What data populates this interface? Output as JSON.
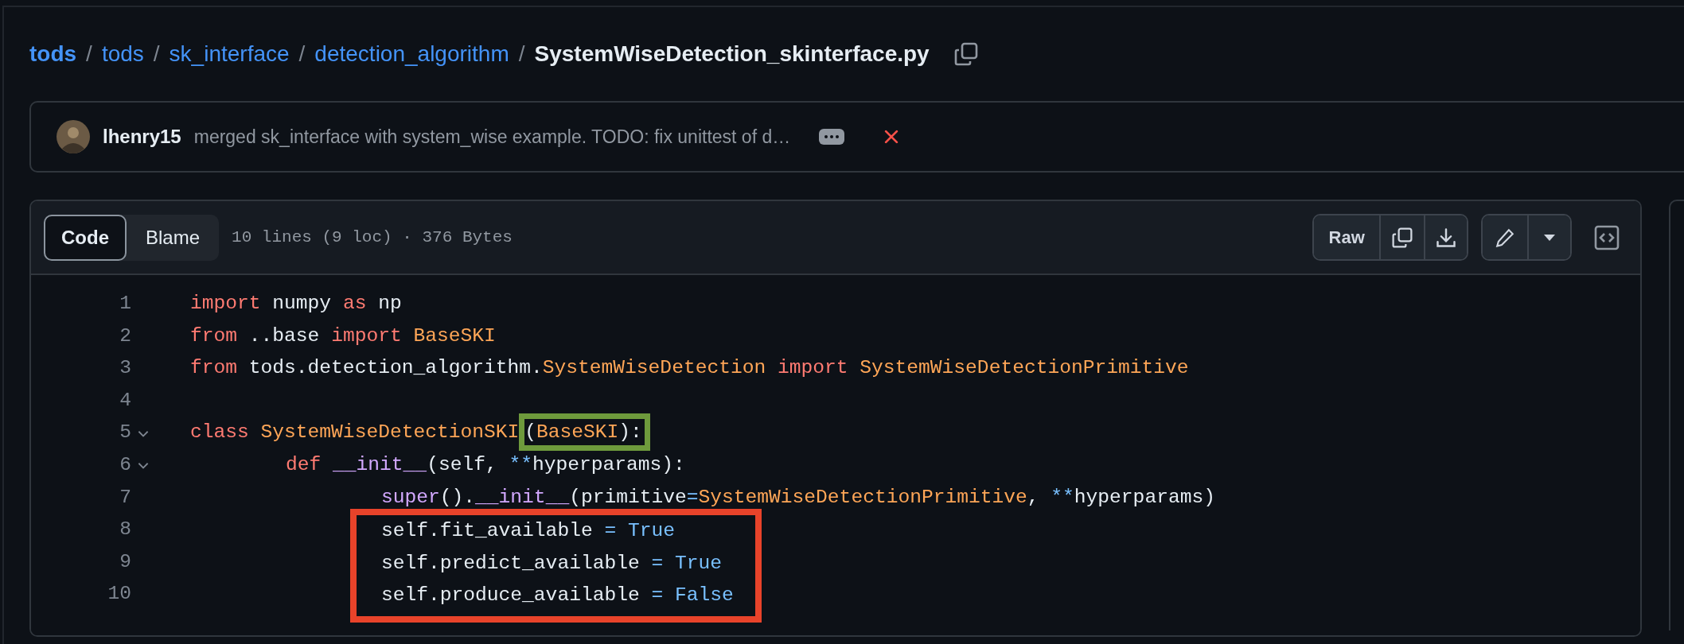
{
  "breadcrumb": [
    {
      "kind": "repo",
      "label": "tods"
    },
    {
      "kind": "separator",
      "label": "/"
    },
    {
      "kind": "link",
      "label": "tods"
    },
    {
      "kind": "separator",
      "label": "/"
    },
    {
      "kind": "link",
      "label": "sk_interface"
    },
    {
      "kind": "separator",
      "label": "/"
    },
    {
      "kind": "link",
      "label": "detection_algorithm"
    },
    {
      "kind": "separator",
      "label": "/"
    },
    {
      "kind": "current",
      "label": "SystemWiseDetection_skinterface.py"
    }
  ],
  "commit": {
    "author": "lhenry15",
    "message": "merged sk_interface with system_wise example. TODO: fix unittest of d…"
  },
  "file_view": {
    "tabs": [
      {
        "label": "Code",
        "selected": true
      },
      {
        "label": "Blame",
        "selected": false
      }
    ],
    "info": "10 lines (9 loc) · 376 Bytes",
    "raw_button": "Raw",
    "lines": [
      {
        "kind": "line",
        "number": "1",
        "tokens": [
          {
            "kind": "keyword",
            "text": "import"
          },
          {
            "kind": "plain",
            "text": " numpy "
          },
          {
            "kind": "keyword",
            "text": "as"
          },
          {
            "kind": "plain",
            "text": " np"
          }
        ]
      },
      {
        "kind": "line",
        "number": "2",
        "tokens": [
          {
            "kind": "keyword",
            "text": "from"
          },
          {
            "kind": "plain",
            "text": " ..base "
          },
          {
            "kind": "keyword",
            "text": "import "
          },
          {
            "kind": "name",
            "text": "BaseSKI"
          }
        ]
      },
      {
        "kind": "line",
        "number": "3",
        "tokens": [
          {
            "kind": "keyword",
            "text": "from"
          },
          {
            "kind": "plain",
            "text": " tods.detection_algorithm."
          },
          {
            "kind": "name",
            "text": "SystemWiseDetection"
          },
          {
            "kind": "keyword",
            "text": " import "
          },
          {
            "kind": "name",
            "text": "SystemWiseDetectionPrimitive"
          }
        ]
      },
      {
        "kind": "line",
        "number": "4"
      },
      {
        "kind": "line",
        "number": "5",
        "expanded": true,
        "tokens": [
          {
            "kind": "keyword",
            "text": "class "
          },
          {
            "kind": "name",
            "text": "SystemWiseDetectionSKI"
          },
          {
            "kind": "frame",
            "color": "#6e9a3c",
            "tokens": [
              {
                "kind": "plain",
                "text": "("
              },
              {
                "kind": "name",
                "text": "BaseSKI"
              },
              {
                "kind": "plain",
                "text": "):"
              }
            ]
          }
        ],
        "children": [
          {
            "kind": "line",
            "number": "6",
            "expanded": true,
            "tokens": [
              {
                "kind": "keyword",
                "text": "def "
              },
              {
                "kind": "function",
                "text": "__init__"
              },
              {
                "kind": "plain",
                "text": "(self, "
              },
              {
                "kind": "operator",
                "text": "**"
              },
              {
                "kind": "plain",
                "text": "hyperparams):"
              }
            ],
            "children": [
              {
                "kind": "line",
                "number": "7",
                "tokens": [
                  {
                    "kind": "function",
                    "text": "super"
                  },
                  {
                    "kind": "plain",
                    "text": "()."
                  },
                  {
                    "kind": "function",
                    "text": "__init__"
                  },
                  {
                    "kind": "plain",
                    "text": "(primitive"
                  },
                  {
                    "kind": "operator",
                    "text": "="
                  },
                  {
                    "kind": "name",
                    "text": "SystemWiseDetectionPrimitive"
                  },
                  {
                    "kind": "plain",
                    "text": ", "
                  },
                  {
                    "kind": "operator",
                    "text": "**"
                  },
                  {
                    "kind": "plain",
                    "text": "hyperparams)"
                  }
                ]
              },
              {
                "kind": "frame",
                "color": "#e8432a",
                "lines": [
                  {
                    "kind": "line",
                    "number": "8",
                    "tokens": [
                      {
                        "kind": "plain",
                        "text": "self.fit_available "
                      },
                      {
                        "kind": "operator",
                        "text": "= "
                      },
                      {
                        "kind": "constant",
                        "text": "True"
                      }
                    ]
                  },
                  {
                    "kind": "line",
                    "number": "9",
                    "tokens": [
                      {
                        "kind": "plain",
                        "text": "self.predict_available "
                      },
                      {
                        "kind": "operator",
                        "text": "= "
                      },
                      {
                        "kind": "constant",
                        "text": "True"
                      }
                    ]
                  },
                  {
                    "kind": "line",
                    "number": "10",
                    "tokens": [
                      {
                        "kind": "plain",
                        "text": "self.produce_available "
                      },
                      {
                        "kind": "operator",
                        "text": "= "
                      },
                      {
                        "kind": "constant",
                        "text": "False"
                      }
                    ]
                  }
                ]
              }
            ]
          }
        ]
      }
    ]
  }
}
